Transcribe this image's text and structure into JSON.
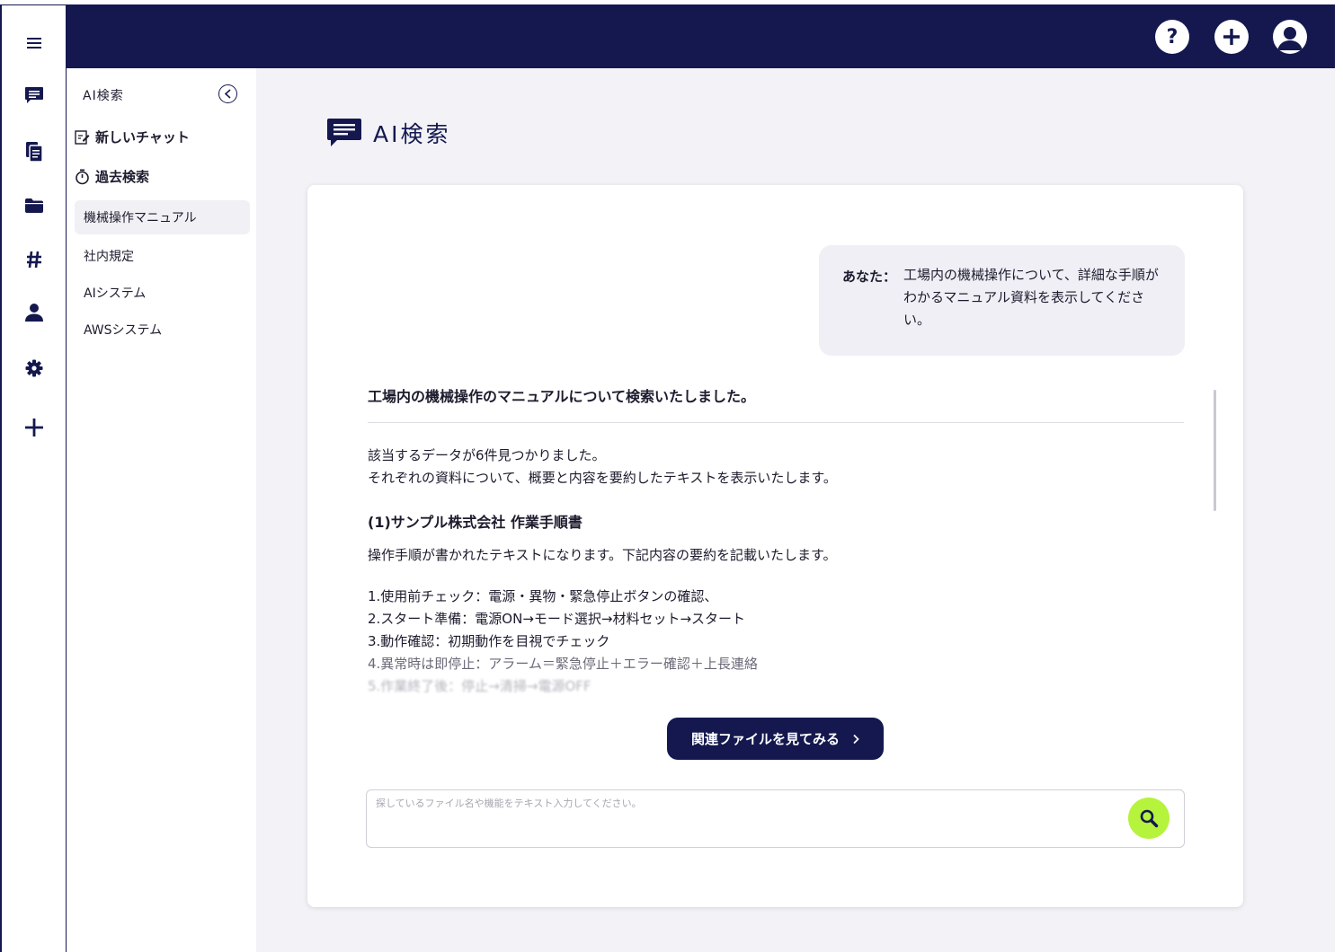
{
  "rail": {
    "items": [
      {
        "icon": "menu-icon"
      },
      {
        "icon": "chat-icon"
      },
      {
        "icon": "documents-icon"
      },
      {
        "icon": "folder-icon"
      },
      {
        "icon": "hashtag-icon"
      },
      {
        "icon": "user-icon"
      },
      {
        "icon": "gear-icon"
      },
      {
        "icon": "plus-icon"
      }
    ]
  },
  "topbar": {
    "help_label": "?",
    "icons": [
      "help-icon",
      "add-circle-icon",
      "account-icon"
    ]
  },
  "sidebar": {
    "header": "AI検索",
    "new_chat": "新しいチャット",
    "past_search": "過去検索",
    "history": [
      {
        "label": "機械操作マニュアル",
        "active": true
      },
      {
        "label": "社内規定",
        "active": false
      },
      {
        "label": "AIシステム",
        "active": false
      },
      {
        "label": "AWSシステム",
        "active": false
      }
    ]
  },
  "main": {
    "title": "AI検索",
    "user_message": {
      "label": "あなた：",
      "text": "工場内の機械操作について、詳細な手順がわかるマニュアル資料を表示してください。"
    },
    "answer": {
      "title": "工場内の機械操作のマニュアルについて検索いたしました。",
      "intro_1": "該当するデータが6件見つかりました。",
      "intro_2": "それぞれの資料について、概要と内容を要約したテキストを表示いたします。",
      "section_title": "(1)サンプル株式会社 作業手順書",
      "summary": "操作手順が書かれたテキストになります。下記内容の要約を記載いたします。",
      "steps": [
        "1.使用前チェック：電源・異物・緊急停止ボタンの確認、",
        "2.スタート準備：電源ON→モード選択→材料セット→スタート",
        "3.動作確認：初期動作を目視でチェック",
        "4.異常時は即停止：アラーム＝緊急停止＋エラー確認＋上長連絡",
        "5.作業終了後：停止→清掃→電源OFF"
      ]
    },
    "related_button": "関連ファイルを見てみる",
    "search": {
      "placeholder": "探しているファイル名や機能をテキスト入力してください。"
    }
  },
  "colors": {
    "navy": "#14184f",
    "accent_green": "#b6f33c",
    "bubble_bg": "#efeff5",
    "main_bg": "#f3f3f7"
  }
}
